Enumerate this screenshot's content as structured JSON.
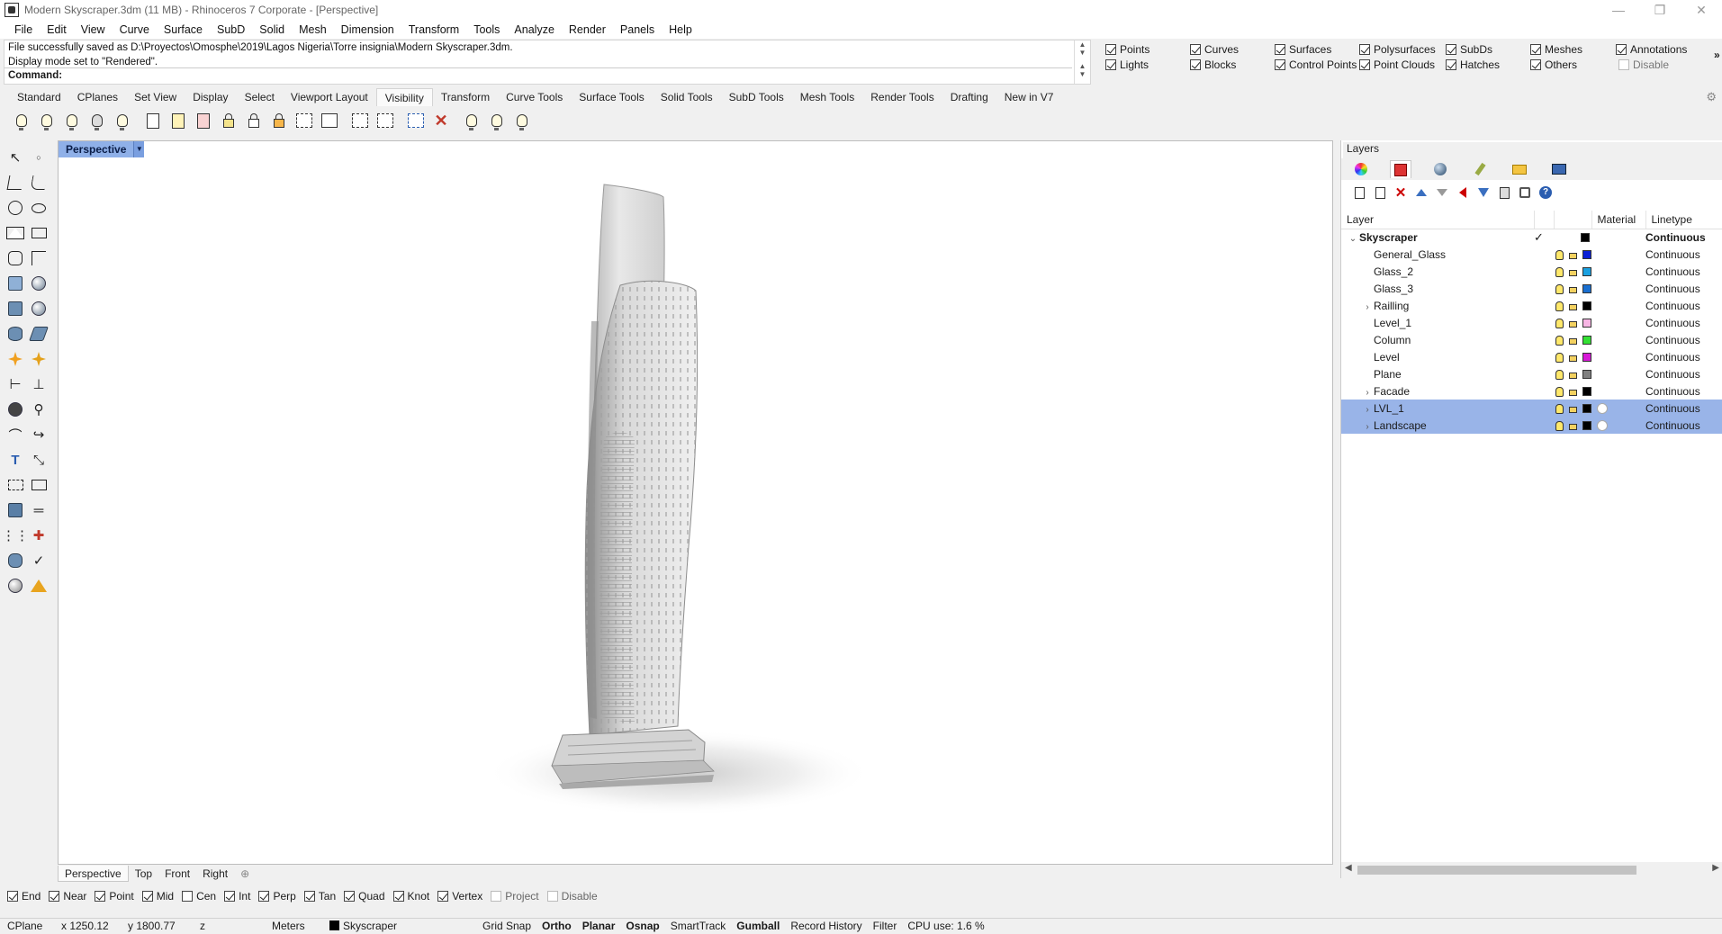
{
  "window": {
    "title": "Modern Skyscraper.3dm (11 MB) - Rhinoceros 7 Corporate - [Perspective]",
    "minimize": "—",
    "restore": "❐",
    "close": "✕"
  },
  "menu": [
    "File",
    "Edit",
    "View",
    "Curve",
    "Surface",
    "SubD",
    "Solid",
    "Mesh",
    "Dimension",
    "Transform",
    "Tools",
    "Analyze",
    "Render",
    "Panels",
    "Help"
  ],
  "command": {
    "history": [
      "File successfully saved as D:\\Proyectos\\Omosphe\\2019\\Lagos Nigeria\\Torre insignia\\Modern Skyscraper.3dm.",
      "Display mode set to \"Rendered\"."
    ],
    "prompt": "Command:"
  },
  "filters": [
    {
      "label": "Points",
      "checked": true
    },
    {
      "label": "Curves",
      "checked": true
    },
    {
      "label": "Surfaces",
      "checked": true
    },
    {
      "label": "Polysurfaces",
      "checked": true
    },
    {
      "label": "SubDs",
      "checked": true
    },
    {
      "label": "Meshes",
      "checked": true
    },
    {
      "label": "Annotations",
      "checked": true
    },
    {
      "label": "Lights",
      "checked": true
    },
    {
      "label": "Blocks",
      "checked": true
    },
    {
      "label": "Control Points",
      "checked": true
    },
    {
      "label": "Point Clouds",
      "checked": true
    },
    {
      "label": "Hatches",
      "checked": true
    },
    {
      "label": "Others",
      "checked": true
    },
    {
      "label": "Disable",
      "checked": false
    }
  ],
  "filters_more": "»",
  "toolbar_tabs": [
    "Standard",
    "CPlanes",
    "Set View",
    "Display",
    "Select",
    "Viewport Layout",
    "Visibility",
    "Transform",
    "Curve Tools",
    "Surface Tools",
    "Solid Tools",
    "SubD Tools",
    "Mesh Tools",
    "Render Tools",
    "Drafting",
    "New in V7"
  ],
  "toolbar_active": "Visibility",
  "toolbar_gear": "⚙",
  "viewport": {
    "name": "Perspective",
    "dropdown": "▼"
  },
  "viewport_tabs": [
    "Perspective",
    "Top",
    "Front",
    "Right"
  ],
  "viewport_tab_add": "⊕",
  "osnaps": [
    {
      "label": "End",
      "checked": true
    },
    {
      "label": "Near",
      "checked": true
    },
    {
      "label": "Point",
      "checked": true
    },
    {
      "label": "Mid",
      "checked": true
    },
    {
      "label": "Cen",
      "checked": false
    },
    {
      "label": "Int",
      "checked": true
    },
    {
      "label": "Perp",
      "checked": true
    },
    {
      "label": "Tan",
      "checked": true
    },
    {
      "label": "Quad",
      "checked": true
    },
    {
      "label": "Knot",
      "checked": true
    },
    {
      "label": "Vertex",
      "checked": true
    },
    {
      "label": "Project",
      "checked": false
    },
    {
      "label": "Disable",
      "checked": false
    }
  ],
  "status": {
    "cplane": "CPlane",
    "x": "x 1250.12",
    "y": "y 1800.77",
    "z": "z",
    "units": "Meters",
    "layer": "Skyscraper",
    "grid_snap": "Grid Snap",
    "ortho": "Ortho",
    "planar": "Planar",
    "osnap": "Osnap",
    "smarttrack": "SmartTrack",
    "gumball": "Gumball",
    "record_history": "Record History",
    "filter": "Filter",
    "cpu": "CPU use: 1.6 %"
  },
  "layers_panel": {
    "title": "Layers",
    "col_layer": "Layer",
    "col_material": "Material",
    "col_linetype": "Linetype",
    "rows": [
      {
        "name": "Skyscraper",
        "expander": "⌄",
        "color": "#000000",
        "current": "✓",
        "linetype": "Continuous",
        "parent": true,
        "selected": false
      },
      {
        "name": "General_Glass",
        "expander": "",
        "color": "#0a1fd6",
        "linetype": "Continuous",
        "selected": false
      },
      {
        "name": "Glass_2",
        "expander": "",
        "color": "#1aa0e0",
        "linetype": "Continuous",
        "selected": false
      },
      {
        "name": "Glass_3",
        "expander": "",
        "color": "#1a6fd0",
        "linetype": "Continuous",
        "selected": false
      },
      {
        "name": "Railling",
        "expander": "›",
        "color": "#000000",
        "linetype": "Continuous",
        "selected": false
      },
      {
        "name": "Level_1",
        "expander": "",
        "color": "#f7b6e4",
        "linetype": "Continuous",
        "selected": false
      },
      {
        "name": "Column",
        "expander": "",
        "color": "#33e033",
        "linetype": "Continuous",
        "selected": false
      },
      {
        "name": "Level",
        "expander": "",
        "color": "#d61ad6",
        "linetype": "Continuous",
        "selected": false
      },
      {
        "name": "Plane",
        "expander": "",
        "color": "#808080",
        "linetype": "Continuous",
        "selected": false
      },
      {
        "name": "Facade",
        "expander": "›",
        "color": "#000000",
        "linetype": "Continuous",
        "selected": false
      },
      {
        "name": "LVL_1",
        "expander": "›",
        "color": "#000000",
        "linetype": "Continuous",
        "selected": true
      },
      {
        "name": "Landscape",
        "expander": "›",
        "color": "#000000",
        "linetype": "Continuous",
        "selected": true
      }
    ],
    "scroll_left": "◀",
    "scroll_right": "▶"
  }
}
